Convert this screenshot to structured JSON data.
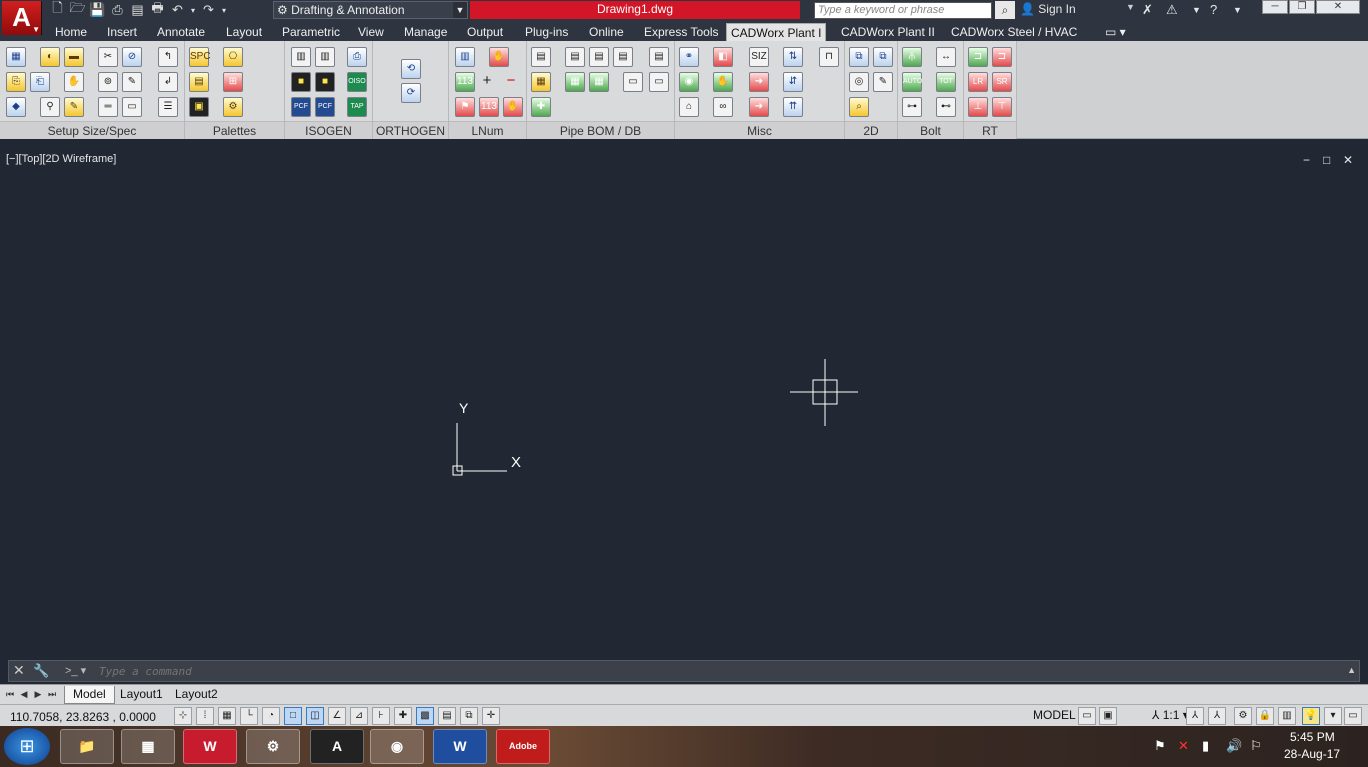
{
  "title_bar": {
    "app_logo": "A",
    "quick_access": [
      "new-icon",
      "open-icon",
      "save-icon",
      "save-as-icon",
      "plot-icon",
      "print-icon",
      "undo-icon",
      "redo-icon"
    ],
    "workspace": "Drafting & Annotation",
    "document_title": "Drawing1.dwg",
    "search_placeholder": "Type a keyword or phrase",
    "sign_in": "Sign In",
    "window_controls": [
      "minimize",
      "restore",
      "close"
    ]
  },
  "ribbon_tabs": [
    {
      "label": "Home",
      "active": false
    },
    {
      "label": "Insert",
      "active": false
    },
    {
      "label": "Annotate",
      "active": false
    },
    {
      "label": "Layout",
      "active": false
    },
    {
      "label": "Parametric",
      "active": false
    },
    {
      "label": "View",
      "active": false
    },
    {
      "label": "Manage",
      "active": false
    },
    {
      "label": "Output",
      "active": false
    },
    {
      "label": "Plug-ins",
      "active": false
    },
    {
      "label": "Online",
      "active": false
    },
    {
      "label": "Express Tools",
      "active": false
    },
    {
      "label": "CADWorx Plant I",
      "active": true
    },
    {
      "label": "CADWorx Plant II",
      "active": false
    },
    {
      "label": "CADWorx Steel / HVAC",
      "active": false
    }
  ],
  "ribbon_panels": [
    {
      "name": "Setup Size/Spec"
    },
    {
      "name": "Palettes"
    },
    {
      "name": "ISOGEN"
    },
    {
      "name": "ORTHOGEN"
    },
    {
      "name": "LNum"
    },
    {
      "name": "Pipe BOM / DB"
    },
    {
      "name": "Misc"
    },
    {
      "name": "2D"
    },
    {
      "name": "Bolt"
    },
    {
      "name": "RT"
    }
  ],
  "icon_labels": {
    "spc": "SPC",
    "pcf_out": "PCF OUT",
    "pcf_in": "PCF IN",
    "oiso": "OISO",
    "tap": "TAP",
    "num": "113",
    "plus": "+",
    "minus": "−",
    "auto": "AUTO",
    "tot": "TOT",
    "lr": "LR",
    "sr": "SR",
    "siz": "SIZ"
  },
  "viewport": {
    "label": "[−][Top][2D Wireframe]",
    "controls": [
      "−",
      "□",
      "✕"
    ],
    "ucs_y": "Y",
    "ucs_x": "X"
  },
  "command_line": {
    "placeholder": "Type a command",
    "close": "✕",
    "prompt": ">_"
  },
  "layout_tabs": [
    {
      "label": "Model",
      "active": true
    },
    {
      "label": "Layout1",
      "active": false
    },
    {
      "label": "Layout2",
      "active": false
    }
  ],
  "status_bar": {
    "coordinates": "110.7058, 23.8263 , 0.0000",
    "model": "MODEL",
    "scale": "1:1"
  },
  "taskbar": {
    "apps": [
      "W",
      "A",
      "W",
      "Adobe"
    ],
    "time": "5:45 PM",
    "date": "28-Aug-17"
  }
}
